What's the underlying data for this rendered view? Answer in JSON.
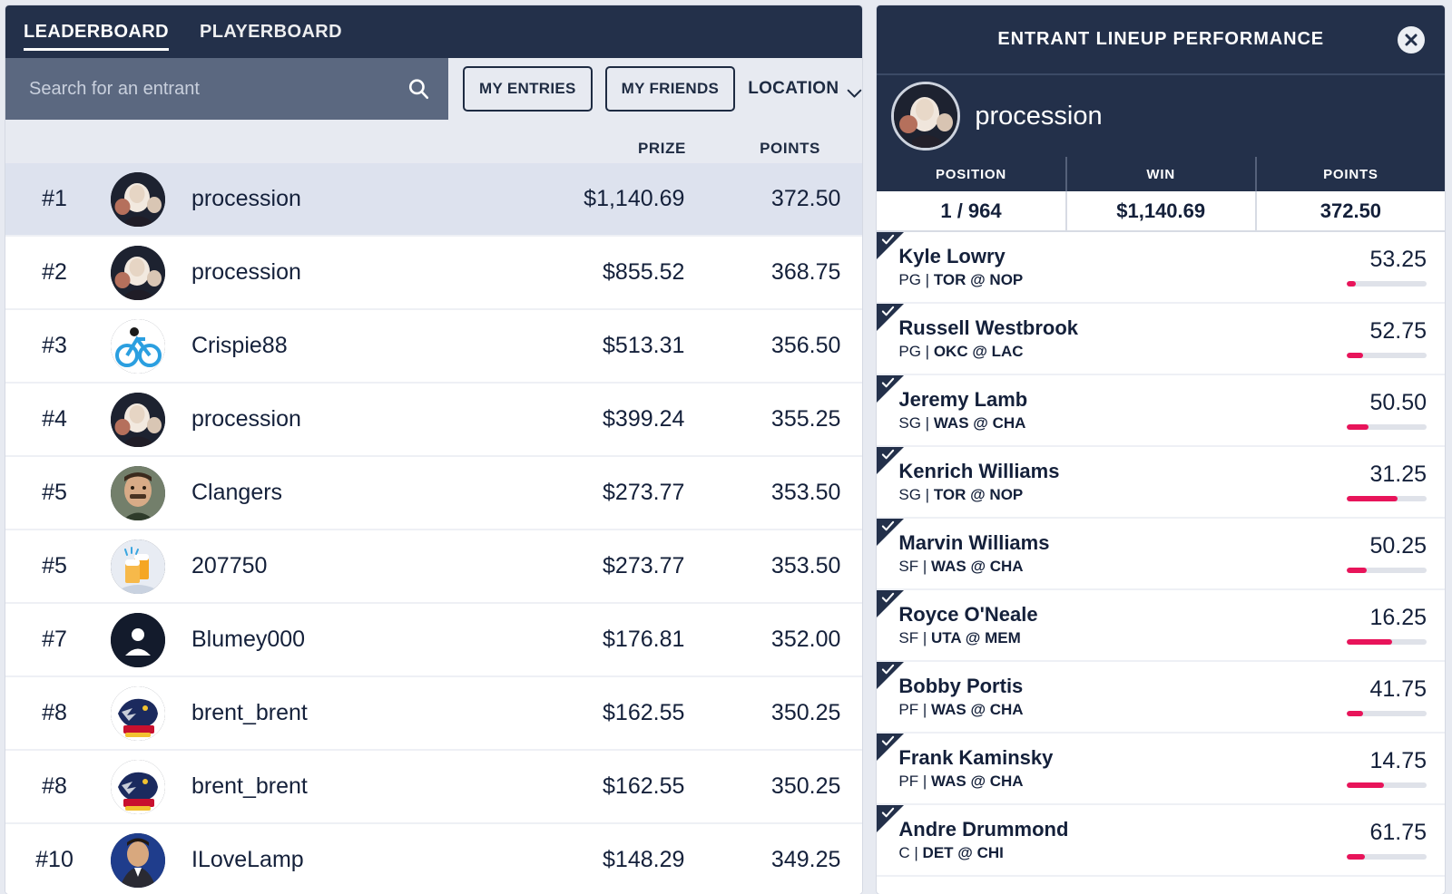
{
  "leaderboard": {
    "tabs": [
      {
        "label": "LEADERBOARD",
        "active": true
      },
      {
        "label": "PLAYERBOARD",
        "active": false
      }
    ],
    "search": {
      "placeholder": "Search for an entrant",
      "value": "",
      "icon": "search-icon"
    },
    "filters": {
      "my_entries_label": "MY ENTRIES",
      "my_friends_label": "MY FRIENDS",
      "location_label": "LOCATION",
      "location_icon": "chevron-down-icon"
    },
    "columns": {
      "prize": "PRIZE",
      "points": "POINTS"
    },
    "rows": [
      {
        "rank": "#1",
        "name": "procession",
        "prize": "$1,140.69",
        "points": "372.50",
        "avatar": "painting",
        "selected": true
      },
      {
        "rank": "#2",
        "name": "procession",
        "prize": "$855.52",
        "points": "368.75",
        "avatar": "painting",
        "selected": false
      },
      {
        "rank": "#3",
        "name": "Crispie88",
        "prize": "$513.31",
        "points": "356.50",
        "avatar": "bicycle",
        "selected": false
      },
      {
        "rank": "#4",
        "name": "procession",
        "prize": "$399.24",
        "points": "355.25",
        "avatar": "painting",
        "selected": false
      },
      {
        "rank": "#5",
        "name": "Clangers",
        "prize": "$273.77",
        "points": "353.50",
        "avatar": "man",
        "selected": false
      },
      {
        "rank": "#5",
        "name": "207750",
        "prize": "$273.77",
        "points": "353.50",
        "avatar": "beer",
        "selected": false
      },
      {
        "rank": "#7",
        "name": "Blumey000",
        "prize": "$176.81",
        "points": "352.00",
        "avatar": "person",
        "selected": false
      },
      {
        "rank": "#8",
        "name": "brent_brent",
        "prize": "$162.55",
        "points": "350.25",
        "avatar": "crows",
        "selected": false
      },
      {
        "rank": "#8",
        "name": "brent_brent",
        "prize": "$162.55",
        "points": "350.25",
        "avatar": "crows",
        "selected": false
      },
      {
        "rank": "#10",
        "name": "ILoveLamp",
        "prize": "$148.29",
        "points": "349.25",
        "avatar": "suit",
        "selected": false
      }
    ]
  },
  "lineup_panel": {
    "title": "ENTRANT LINEUP PERFORMANCE",
    "close_icon": "close-icon",
    "entrant_name": "procession",
    "entrant_avatar": "painting",
    "stat_headers": [
      "POSITION",
      "WIN",
      "POINTS"
    ],
    "stat_values": [
      "1 / 964",
      "$1,140.69",
      "372.50"
    ],
    "players": [
      {
        "name": "Kyle Lowry",
        "position": "PG",
        "matchup": "TOR @ NOP",
        "score": "53.25",
        "bar_pct": 11
      },
      {
        "name": "Russell Westbrook",
        "position": "PG",
        "matchup": "OKC @ LAC",
        "score": "52.75",
        "bar_pct": 21
      },
      {
        "name": "Jeremy Lamb",
        "position": "SG",
        "matchup": "WAS @ CHA",
        "score": "50.50",
        "bar_pct": 27
      },
      {
        "name": "Kenrich Williams",
        "position": "SG",
        "matchup": "TOR @ NOP",
        "score": "31.25",
        "bar_pct": 64
      },
      {
        "name": "Marvin Williams",
        "position": "SF",
        "matchup": "WAS @ CHA",
        "score": "50.25",
        "bar_pct": 25
      },
      {
        "name": "Royce O'Neale",
        "position": "SF",
        "matchup": "UTA @ MEM",
        "score": "16.25",
        "bar_pct": 57
      },
      {
        "name": "Bobby Portis",
        "position": "PF",
        "matchup": "WAS @ CHA",
        "score": "41.75",
        "bar_pct": 20
      },
      {
        "name": "Frank Kaminsky",
        "position": "PF",
        "matchup": "WAS @ CHA",
        "score": "14.75",
        "bar_pct": 47
      },
      {
        "name": "Andre Drummond",
        "position": "C",
        "matchup": "DET @ CHI",
        "score": "61.75",
        "bar_pct": 23
      }
    ]
  },
  "colors": {
    "navy": "#23304a",
    "page_bg": "#e7eaf1",
    "selected_row": "#dde2ee",
    "accent_pink": "#e8145a",
    "search_bg": "#5b6880"
  }
}
